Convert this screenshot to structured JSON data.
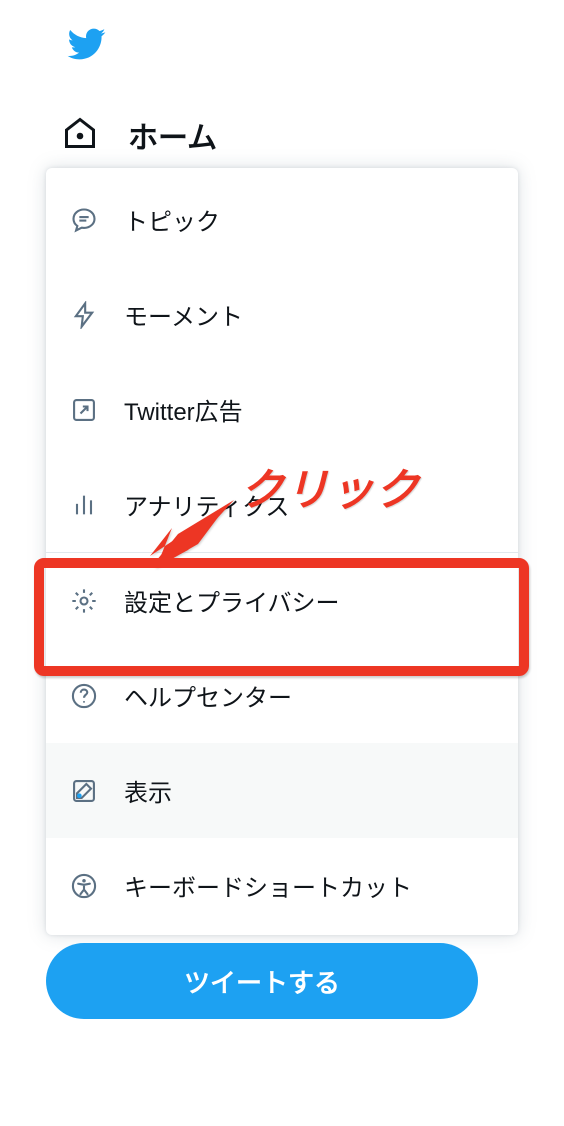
{
  "nav": {
    "home_label": "ホーム"
  },
  "menu": {
    "items": [
      {
        "id": "topics",
        "label": "トピック"
      },
      {
        "id": "moments",
        "label": "モーメント"
      },
      {
        "id": "twitter_ads",
        "label": "Twitter広告"
      },
      {
        "id": "analytics",
        "label": "アナリティクス"
      },
      {
        "id": "settings_privacy",
        "label": "設定とプライバシー"
      },
      {
        "id": "help_center",
        "label": "ヘルプセンター"
      },
      {
        "id": "display",
        "label": "表示"
      },
      {
        "id": "keyboard_shortcuts",
        "label": "キーボードショートカット"
      }
    ]
  },
  "tweet_button_label": "ツイートする",
  "annotation_text": "クリック",
  "colors": {
    "brand": "#1DA1F2",
    "highlight": "#ed3624",
    "text": "#0f1419",
    "icon": "#5b7083"
  }
}
